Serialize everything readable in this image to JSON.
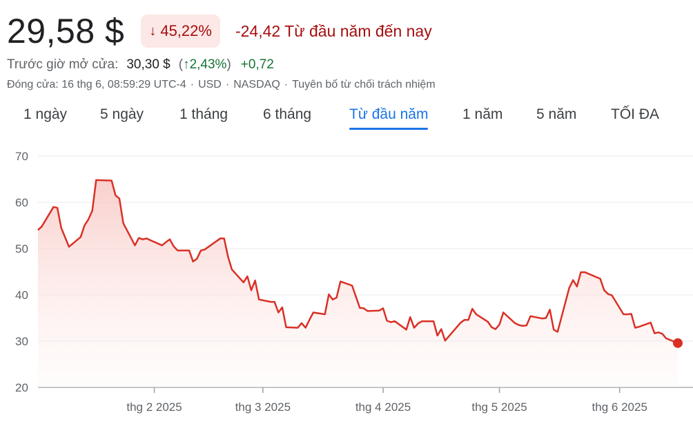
{
  "quote": {
    "price": "29,58 $",
    "pct_change": "45,22%",
    "pct_arrow": "↓",
    "change_text": "-24,42 Từ đầu năm đến nay"
  },
  "premarket": {
    "label": "Trước giờ mở cửa:",
    "price": "30,30 $",
    "paren_open": "(",
    "arrow": "↑",
    "pct": "2,43%",
    "paren_close": ")",
    "abs_change": "+0,72"
  },
  "meta": {
    "close": "Đóng cửa: 16 thg 6, 08:59:29 UTC-4",
    "currency": "USD",
    "exchange": "NASDAQ",
    "disclaimer": "Tuyên bố từ chối trách nhiệm",
    "sep": "·"
  },
  "tabs": [
    {
      "label": "1 ngày"
    },
    {
      "label": "5 ngày"
    },
    {
      "label": "1 tháng"
    },
    {
      "label": "6 tháng"
    },
    {
      "label": "Từ đầu năm",
      "active": true
    },
    {
      "label": "1 năm"
    },
    {
      "label": "5 năm"
    },
    {
      "label": "TỐI ĐA"
    }
  ],
  "colors": {
    "line": "#d93025",
    "fill": "#f8c7c3",
    "grid": "#e8eaed",
    "axis": "#9aa0a6",
    "active_tab": "#1a73e8",
    "negative": "#a50e0e",
    "positive": "#137333"
  },
  "chart_data": {
    "type": "area",
    "xlabel": "",
    "ylabel": "",
    "ylim": [
      20,
      70
    ],
    "yticks": [
      20,
      30,
      40,
      50,
      60,
      70
    ],
    "xlim": [
      "2025-01-02",
      "2025-06-16"
    ],
    "xticks": [
      {
        "date": "2025-02-01",
        "label": "thg 2 2025"
      },
      {
        "date": "2025-03-01",
        "label": "thg 3 2025"
      },
      {
        "date": "2025-04-01",
        "label": "thg 4 2025"
      },
      {
        "date": "2025-05-01",
        "label": "thg 5 2025"
      },
      {
        "date": "2025-06-01",
        "label": "thg 6 2025"
      }
    ],
    "grid": true,
    "series": [
      {
        "points": [
          [
            "2025-01-02",
            54.0
          ],
          [
            "2025-01-03",
            54.8
          ],
          [
            "2025-01-06",
            59.0
          ],
          [
            "2025-01-07",
            58.8
          ],
          [
            "2025-01-08",
            54.5
          ],
          [
            "2025-01-10",
            50.4
          ],
          [
            "2025-01-13",
            52.5
          ],
          [
            "2025-01-14",
            55.0
          ],
          [
            "2025-01-15",
            56.3
          ],
          [
            "2025-01-16",
            58.2
          ],
          [
            "2025-01-17",
            64.8
          ],
          [
            "2025-01-21",
            64.7
          ],
          [
            "2025-01-22",
            61.5
          ],
          [
            "2025-01-23",
            60.8
          ],
          [
            "2025-01-24",
            55.5
          ],
          [
            "2025-01-27",
            50.7
          ],
          [
            "2025-01-28",
            52.3
          ],
          [
            "2025-01-29",
            52.0
          ],
          [
            "2025-01-30",
            52.2
          ],
          [
            "2025-01-31",
            51.8
          ],
          [
            "2025-02-03",
            50.7
          ],
          [
            "2025-02-04",
            51.4
          ],
          [
            "2025-02-05",
            52.0
          ],
          [
            "2025-02-06",
            50.5
          ],
          [
            "2025-02-07",
            49.6
          ],
          [
            "2025-02-10",
            49.6
          ],
          [
            "2025-02-11",
            47.2
          ],
          [
            "2025-02-12",
            47.8
          ],
          [
            "2025-02-13",
            49.6
          ],
          [
            "2025-02-14",
            49.8
          ],
          [
            "2025-02-18",
            52.2
          ],
          [
            "2025-02-19",
            52.2
          ],
          [
            "2025-02-20",
            48.3
          ],
          [
            "2025-02-21",
            45.5
          ],
          [
            "2025-02-24",
            42.7
          ],
          [
            "2025-02-25",
            44.0
          ],
          [
            "2025-02-26",
            41.0
          ],
          [
            "2025-02-27",
            43.1
          ],
          [
            "2025-02-28",
            39.0
          ],
          [
            "2025-03-03",
            38.5
          ],
          [
            "2025-03-04",
            38.5
          ],
          [
            "2025-03-05",
            36.2
          ],
          [
            "2025-03-06",
            37.3
          ],
          [
            "2025-03-07",
            33.0
          ],
          [
            "2025-03-10",
            32.9
          ],
          [
            "2025-03-11",
            33.9
          ],
          [
            "2025-03-12",
            32.9
          ],
          [
            "2025-03-13",
            34.6
          ],
          [
            "2025-03-14",
            36.2
          ],
          [
            "2025-03-17",
            35.8
          ],
          [
            "2025-03-18",
            40.1
          ],
          [
            "2025-03-19",
            39.0
          ],
          [
            "2025-03-20",
            39.4
          ],
          [
            "2025-03-21",
            42.9
          ],
          [
            "2025-03-24",
            42.0
          ],
          [
            "2025-03-25",
            39.6
          ],
          [
            "2025-03-26",
            37.2
          ],
          [
            "2025-03-27",
            37.1
          ],
          [
            "2025-03-28",
            36.5
          ],
          [
            "2025-03-31",
            36.6
          ],
          [
            "2025-04-01",
            37.1
          ],
          [
            "2025-04-02",
            34.4
          ],
          [
            "2025-04-03",
            34.1
          ],
          [
            "2025-04-04",
            34.3
          ],
          [
            "2025-04-07",
            32.5
          ],
          [
            "2025-04-08",
            35.2
          ],
          [
            "2025-04-09",
            32.9
          ],
          [
            "2025-04-10",
            33.8
          ],
          [
            "2025-04-11",
            34.3
          ],
          [
            "2025-04-14",
            34.3
          ],
          [
            "2025-04-15",
            31.2
          ],
          [
            "2025-04-16",
            32.6
          ],
          [
            "2025-04-17",
            30.1
          ],
          [
            "2025-04-21",
            34.0
          ],
          [
            "2025-04-22",
            34.6
          ],
          [
            "2025-04-23",
            34.6
          ],
          [
            "2025-04-24",
            37.0
          ],
          [
            "2025-04-25",
            35.8
          ],
          [
            "2025-04-28",
            34.2
          ],
          [
            "2025-04-29",
            33.0
          ],
          [
            "2025-04-30",
            32.6
          ],
          [
            "2025-05-01",
            33.6
          ],
          [
            "2025-05-02",
            36.2
          ],
          [
            "2025-05-05",
            33.9
          ],
          [
            "2025-05-06",
            33.5
          ],
          [
            "2025-05-07",
            33.3
          ],
          [
            "2025-05-08",
            33.4
          ],
          [
            "2025-05-09",
            35.4
          ],
          [
            "2025-05-12",
            34.9
          ],
          [
            "2025-05-13",
            35.0
          ],
          [
            "2025-05-14",
            36.8
          ],
          [
            "2025-05-15",
            32.5
          ],
          [
            "2025-05-16",
            32.0
          ],
          [
            "2025-05-19",
            41.5
          ],
          [
            "2025-05-20",
            43.2
          ],
          [
            "2025-05-21",
            41.8
          ],
          [
            "2025-05-22",
            44.9
          ],
          [
            "2025-05-23",
            44.9
          ],
          [
            "2025-05-27",
            43.5
          ],
          [
            "2025-05-28",
            41.0
          ],
          [
            "2025-05-29",
            40.2
          ],
          [
            "2025-05-30",
            39.9
          ],
          [
            "2025-06-02",
            35.8
          ],
          [
            "2025-06-03",
            35.8
          ],
          [
            "2025-06-04",
            35.9
          ],
          [
            "2025-06-05",
            32.9
          ],
          [
            "2025-06-06",
            33.1
          ],
          [
            "2025-06-09",
            34.0
          ],
          [
            "2025-06-10",
            31.7
          ],
          [
            "2025-06-11",
            31.9
          ],
          [
            "2025-06-12",
            31.6
          ],
          [
            "2025-06-13",
            30.6
          ],
          [
            "2025-06-16",
            29.58
          ]
        ]
      }
    ]
  }
}
